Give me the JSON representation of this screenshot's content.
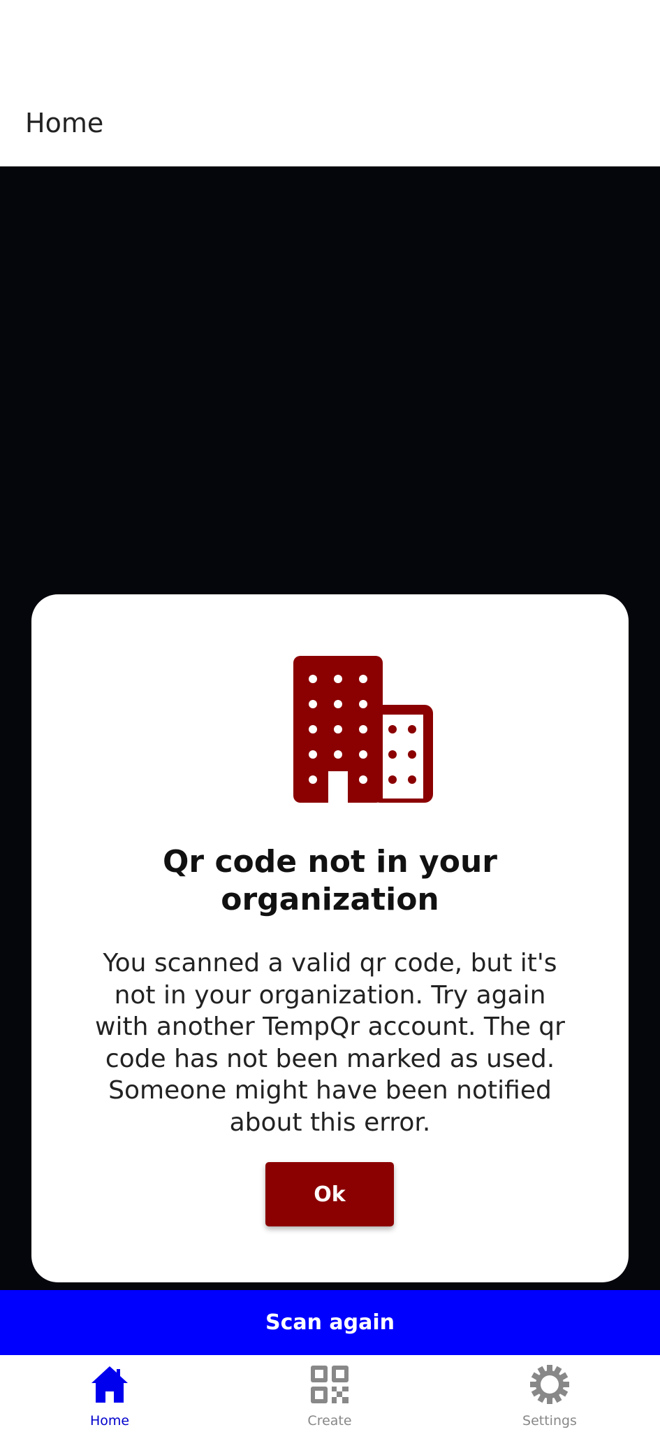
{
  "header": {
    "title": "Home"
  },
  "dialog": {
    "icon": "building-icon",
    "title": "Qr code not in your organization",
    "message": "You scanned a valid qr code, but it's not in your organization. Try again with another TempQr account. The qr code has not been marked as used. Someone might have been notified about this error.",
    "ok_label": "Ok"
  },
  "scan_again_label": "Scan again",
  "nav": {
    "items": [
      {
        "label": "Home",
        "icon": "home-icon",
        "active": true
      },
      {
        "label": "Create",
        "icon": "qr-code-icon",
        "active": false
      },
      {
        "label": "Settings",
        "icon": "gear-icon",
        "active": false
      }
    ]
  },
  "colors": {
    "accent_red": "#8b0000",
    "scan_bar_blue": "#0000ff",
    "nav_active": "#0000cc",
    "nav_inactive": "#888888",
    "camera_background": "#05050c"
  }
}
